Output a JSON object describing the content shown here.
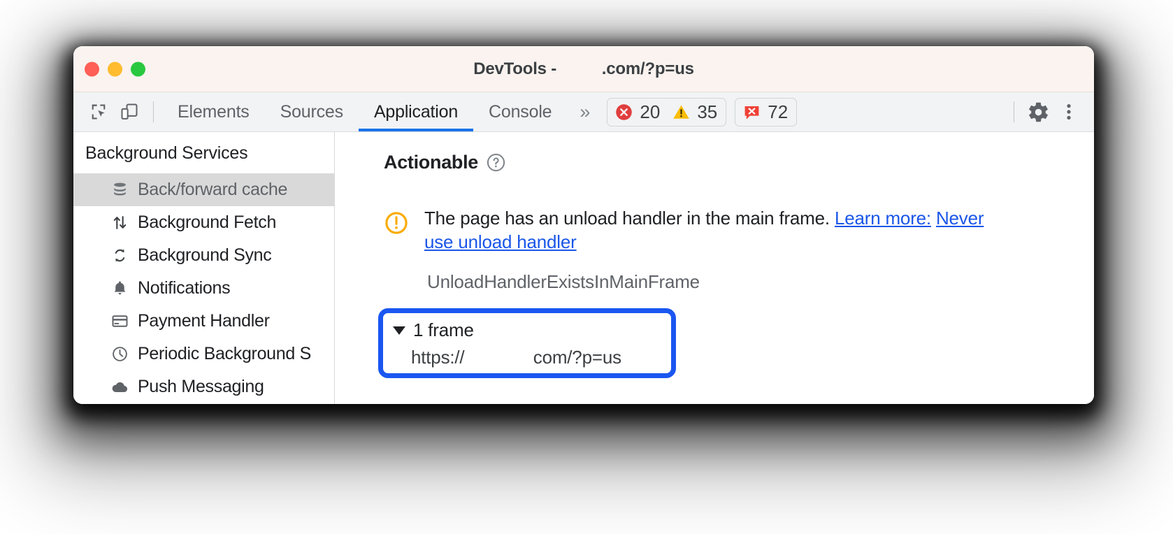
{
  "window": {
    "title": "DevTools -          .com/?p=us",
    "traffic_lights": [
      "close",
      "minimize",
      "maximize"
    ]
  },
  "toolbar": {
    "inspect_icon": "inspect-element-icon",
    "device_icon": "device-toolbar-icon",
    "tabs": [
      {
        "label": "Elements",
        "active": false
      },
      {
        "label": "Sources",
        "active": false
      },
      {
        "label": "Application",
        "active": true
      },
      {
        "label": "Console",
        "active": false
      }
    ],
    "more_tabs_label": "»",
    "badges": [
      {
        "name": "errors",
        "icon": "error-circle-icon",
        "count": "20",
        "color": "#e03e3e"
      },
      {
        "name": "warnings",
        "icon": "warning-triangle-icon",
        "count": "35",
        "color": "#fbbc04"
      },
      {
        "name": "issues",
        "icon": "issue-bubble-icon",
        "count": "72",
        "color": "#ef4136"
      }
    ],
    "settings_label": "gear-icon",
    "menu_label": "kebab-menu-icon",
    "active_tab_underline_color": "#1a73e8"
  },
  "sidebar": {
    "title": "Background Services",
    "items": [
      {
        "label": "Back/forward cache",
        "icon": "database-stack-icon",
        "selected": true
      },
      {
        "label": "Background Fetch",
        "icon": "up-down-arrows-icon",
        "selected": false
      },
      {
        "label": "Background Sync",
        "icon": "sync-refresh-icon",
        "selected": false
      },
      {
        "label": "Notifications",
        "icon": "bell-icon",
        "selected": false
      },
      {
        "label": "Payment Handler",
        "icon": "credit-card-icon",
        "selected": false
      },
      {
        "label": "Periodic Background S",
        "icon": "clock-icon",
        "selected": false
      },
      {
        "label": "Push Messaging",
        "icon": "cloud-icon",
        "selected": false
      }
    ],
    "selected_background": "#d9d9d9"
  },
  "main": {
    "section_title": "Actionable",
    "help_icon": "help-circle-icon",
    "issue": {
      "icon": "warning-circle-icon",
      "icon_color": "#f9ab00",
      "text": "The page has an unload handler in the main frame. ",
      "link_text_part1": "Learn more:",
      "link_text_part2": "Never use unload handler",
      "link_color": "#1a56e8"
    },
    "reason_code": "UnloadHandlerExistsInMainFrame",
    "frames": {
      "highlight_color": "#1a56f0",
      "toggle_caret": "expanded",
      "summary": "1 frame",
      "url": "https://              com/?p=us"
    }
  }
}
